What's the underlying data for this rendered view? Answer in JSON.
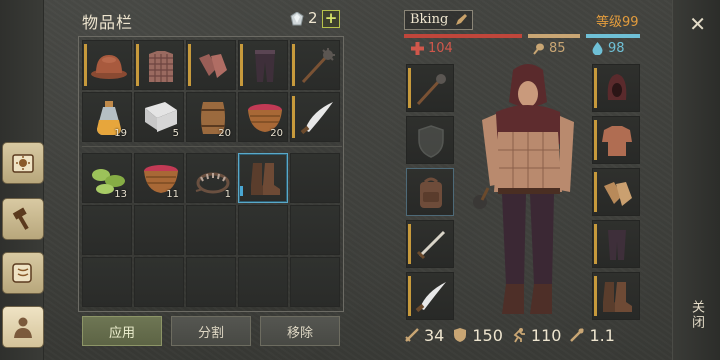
{
  "inventory": {
    "title": "物品栏",
    "gems": "2",
    "plus_label": "+",
    "top_grid": [
      {
        "icon": "helmet-icon",
        "qty": "",
        "bar": true
      },
      {
        "icon": "chainmail-icon",
        "qty": "",
        "bar": true
      },
      {
        "icon": "gloves-icon",
        "qty": "",
        "bar": true
      },
      {
        "icon": "pants-icon",
        "qty": "",
        "bar": true
      },
      {
        "icon": "mace-icon",
        "qty": "",
        "bar": true
      },
      {
        "icon": "potion-icon",
        "qty": "19",
        "bar": false
      },
      {
        "icon": "cloth-icon",
        "qty": "5",
        "bar": false
      },
      {
        "icon": "barrel-icon",
        "qty": "20",
        "bar": false
      },
      {
        "icon": "berry-basket-icon",
        "qty": "20",
        "bar": false
      },
      {
        "icon": "saber-icon",
        "qty": "",
        "bar": true
      }
    ],
    "bottom_grid": [
      {
        "icon": "herbs-icon",
        "qty": "13",
        "bar": false
      },
      {
        "icon": "berry-basket-icon",
        "qty": "11",
        "bar": false
      },
      {
        "icon": "bear-trap-icon",
        "qty": "1",
        "bar": false
      },
      {
        "icon": "boots-icon",
        "qty": "",
        "bar": true,
        "selected": true
      },
      {
        "icon": "",
        "qty": ""
      },
      {
        "icon": "",
        "qty": ""
      },
      {
        "icon": "",
        "qty": ""
      },
      {
        "icon": "",
        "qty": ""
      },
      {
        "icon": "",
        "qty": ""
      },
      {
        "icon": "",
        "qty": ""
      },
      {
        "icon": "",
        "qty": ""
      },
      {
        "icon": "",
        "qty": ""
      },
      {
        "icon": "",
        "qty": ""
      },
      {
        "icon": "",
        "qty": ""
      },
      {
        "icon": "",
        "qty": ""
      }
    ]
  },
  "buttons": {
    "apply": "应用",
    "split": "分割",
    "remove": "移除"
  },
  "character": {
    "name": "Bking",
    "level": "等级99",
    "health": "104",
    "food": "85",
    "water": "98",
    "health_fill": 1.0,
    "food_fill": 1.0,
    "water_fill": 1.0
  },
  "equipment": {
    "left": [
      "mace-icon",
      "shield-icon",
      "backpack-icon",
      "sword-icon",
      "saber-icon"
    ],
    "right": [
      "hood-icon",
      "shirt-icon",
      "gloves-icon",
      "pants-icon",
      "boots-icon"
    ]
  },
  "bottom_stats": {
    "damage": "34",
    "armor": "150",
    "speed": "110",
    "weight": "1.1"
  },
  "close": {
    "x": "✕",
    "label": "关闭"
  },
  "colors": {
    "accent_gold": "#c79a3c",
    "health_red": "#c0463b",
    "food_tan": "#c9a674",
    "water_blue": "#6fc0d6",
    "level_orange": "#e39c3d"
  }
}
